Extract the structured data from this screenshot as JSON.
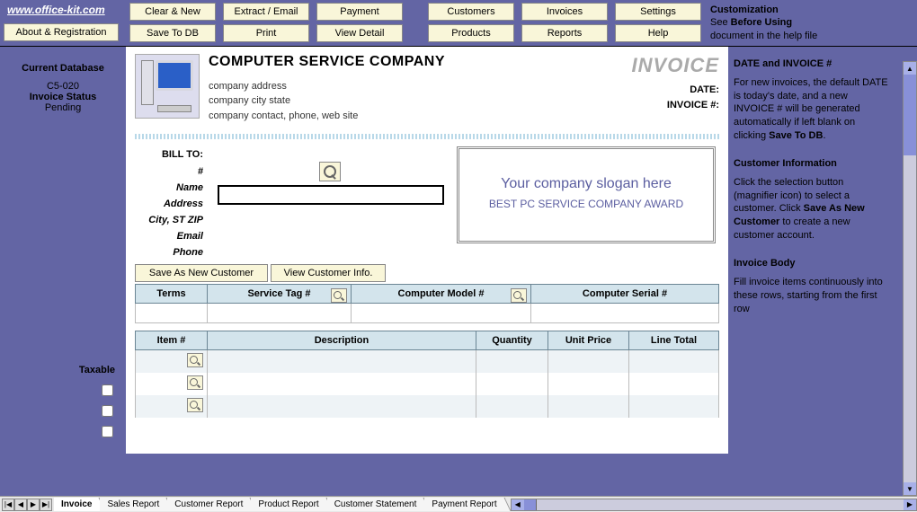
{
  "url": "www.office-kit.com",
  "toolbar": {
    "about": "About & Registration",
    "clear": "Clear & New",
    "save_db": "Save To DB",
    "extract": "Extract / Email",
    "print": "Print",
    "payment": "Payment",
    "view_detail": "View Detail",
    "customers": "Customers",
    "products": "Products",
    "invoices": "Invoices",
    "reports": "Reports",
    "settings": "Settings",
    "help": "Help"
  },
  "customization": {
    "title": "Customization",
    "line1": "See ",
    "bold1": "Before Using",
    "line2": "document in the help file"
  },
  "left": {
    "heading": "Current Database",
    "db": "C5-020",
    "status_label": "Invoice Status",
    "status": "Pending",
    "taxable": "Taxable"
  },
  "company": {
    "name": "COMPUTER SERVICE COMPANY",
    "addr": "company address",
    "city": "company city state",
    "contact": "company contact, phone, web site"
  },
  "invoice_label": "INVOICE",
  "date_label": "DATE:",
  "invno_label": "INVOICE #:",
  "billto": {
    "title": "BILL TO:",
    "num": "#",
    "name": "Name",
    "address": "Address",
    "csz": "City, ST ZIP",
    "email": "Email",
    "phone": "Phone"
  },
  "slogan": "Your company slogan here",
  "award": "BEST PC SERVICE COMPANY AWARD",
  "cust_btns": {
    "save": "Save As New Customer",
    "view": "View Customer Info."
  },
  "table1_headers": [
    "Terms",
    "Service Tag #",
    "Computer Model #",
    "Computer Serial #"
  ],
  "table2_headers": [
    "Item #",
    "Description",
    "Quantity",
    "Unit Price",
    "Line Total"
  ],
  "help_panel": {
    "h1": "DATE and INVOICE #",
    "p1a": "For new invoices, the default DATE is today's date, and a new INVOICE # will be generated automatically if left blank on clicking ",
    "p1b": "Save To DB",
    "h2": "Customer Information",
    "p2a": "Click the selection button (magnifier icon) to select a customer. Click ",
    "p2b": "Save As New Customer",
    "p2c": " to create a new customer account.",
    "h3": "Invoice Body",
    "p3": "Fill invoice items continuously into these rows, starting from the first row"
  },
  "tabs": [
    "Invoice",
    "Sales Report",
    "Customer Report",
    "Product Report",
    "Customer Statement",
    "Payment Report"
  ]
}
